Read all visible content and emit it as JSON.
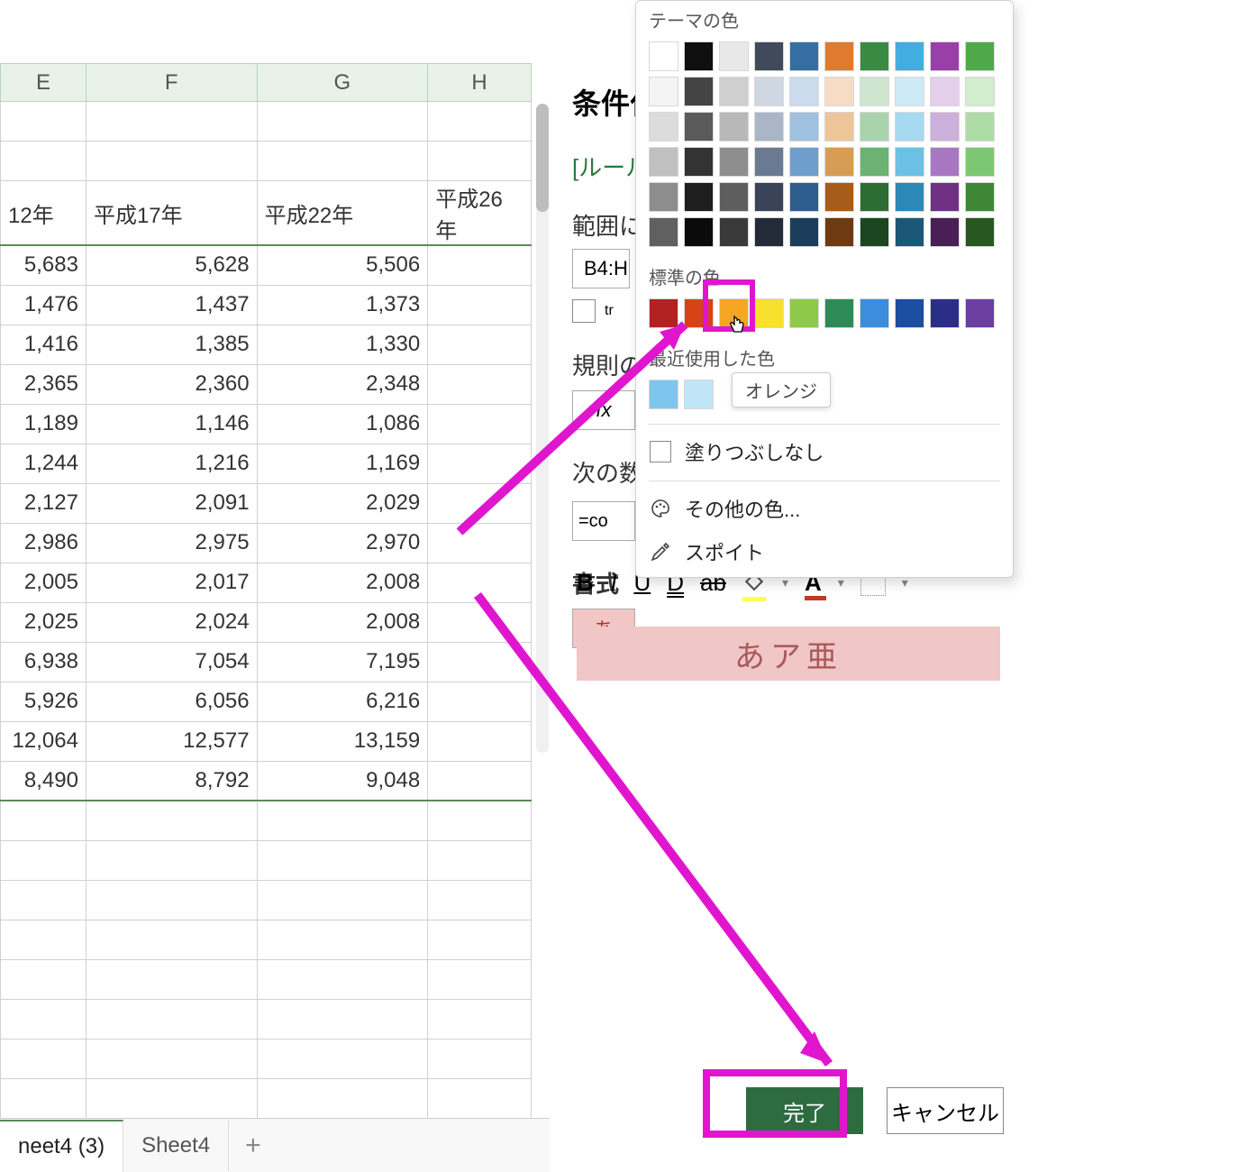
{
  "sheet": {
    "col_letters": [
      "E",
      "F",
      "G",
      "H"
    ],
    "headers": [
      "12年",
      "平成17年",
      "平成22年",
      "平成26年"
    ],
    "rows": [
      [
        "5,683",
        "5,628",
        "5,506",
        ""
      ],
      [
        "1,476",
        "1,437",
        "1,373",
        ""
      ],
      [
        "1,416",
        "1,385",
        "1,330",
        ""
      ],
      [
        "2,365",
        "2,360",
        "2,348",
        ""
      ],
      [
        "1,189",
        "1,146",
        "1,086",
        ""
      ],
      [
        "1,244",
        "1,216",
        "1,169",
        ""
      ],
      [
        "2,127",
        "2,091",
        "2,029",
        ""
      ],
      [
        "2,986",
        "2,975",
        "2,970",
        ""
      ],
      [
        "2,005",
        "2,017",
        "2,008",
        ""
      ],
      [
        "2,025",
        "2,024",
        "2,008",
        ""
      ],
      [
        "6,938",
        "7,054",
        "7,195",
        ""
      ],
      [
        "5,926",
        "6,056",
        "6,216",
        ""
      ],
      [
        "12,064",
        "12,577",
        "13,159",
        ""
      ],
      [
        "8,490",
        "8,792",
        "9,048",
        ""
      ]
    ],
    "tabs": [
      "neet4 (3)",
      "Sheet4"
    ],
    "add_sheet": "+"
  },
  "pane": {
    "title": "条件付",
    "link": "[ルール",
    "range_label": "範囲に",
    "range_value": "B4:H",
    "checkbox_label": "tr",
    "rule_label": "規則の",
    "fx": "fx",
    "next_label": "次の数",
    "formula_value": "=co",
    "format_label": "書式",
    "format_btn": "あ",
    "preview": "あア亜"
  },
  "picker": {
    "section_theme": "テーマの色",
    "section_standard": "標準の色",
    "section_recent": "最近使用した色",
    "tooltip": "オレンジ",
    "nofill": "塗りつぶしなし",
    "morecolors": "その他の色...",
    "eyedropper": "スポイト",
    "theme_base": [
      "#ffffff",
      "#0f0f0f",
      "#e8e8e8",
      "#404a5a",
      "#356fa2",
      "#e07b2e",
      "#3a8a44",
      "#42aee0",
      "#9b3fa8",
      "#4fa84a"
    ],
    "theme_shades": [
      [
        "#f4f4f4",
        "#444444",
        "#cfcfcf",
        "#cfd7e2",
        "#c9dbec",
        "#f6dcc4",
        "#cee6d0",
        "#cfeaf7",
        "#e3cfeb",
        "#d2ecce"
      ],
      [
        "#dcdcdc",
        "#5a5a5a",
        "#b8b8b8",
        "#aab6c8",
        "#9fc0de",
        "#eec598",
        "#a9d3ad",
        "#a7d9f0",
        "#ccafdb",
        "#aedca7"
      ],
      [
        "#c0c0c0",
        "#333333",
        "#8e8e8e",
        "#6b7a93",
        "#6e9fcc",
        "#d79c54",
        "#6bb273",
        "#6bc1e4",
        "#a877c3",
        "#7cc772"
      ],
      [
        "#8d8d8d",
        "#1e1e1e",
        "#5e5e5e",
        "#394458",
        "#2d5d8c",
        "#a85c19",
        "#2d6d34",
        "#2c88b6",
        "#703184",
        "#3f8636"
      ],
      [
        "#606060",
        "#0b0b0b",
        "#3a3a3a",
        "#232b39",
        "#1d3d5c",
        "#6d3b0f",
        "#1c4620",
        "#1b5875",
        "#491f56",
        "#285722"
      ]
    ],
    "standard": [
      "#b22222",
      "#d84315",
      "#f5a623",
      "#f7e02e",
      "#8fc94b",
      "#2e8b57",
      "#3c8ddb",
      "#1b4ea0",
      "#2b2e87",
      "#6a3fa0"
    ],
    "recent": [
      "#7fc6ee",
      "#bfe4f6"
    ]
  },
  "buttons": {
    "done": "完了",
    "cancel": "キャンセル"
  }
}
